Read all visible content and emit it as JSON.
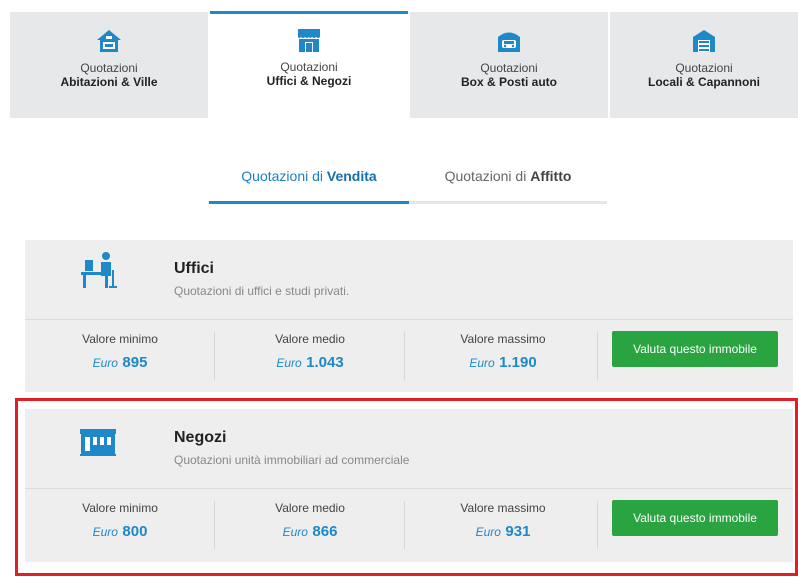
{
  "category_tabs": [
    {
      "line1": "Quotazioni",
      "line2": "Abitazioni & Ville",
      "icon": "house-icon",
      "active": false
    },
    {
      "line1": "Quotazioni",
      "line2": "Uffici & Negozi",
      "icon": "shop-icon",
      "active": true
    },
    {
      "line1": "Quotazioni",
      "line2": "Box & Posti auto",
      "icon": "garage-car-icon",
      "active": false
    },
    {
      "line1": "Quotazioni",
      "line2": "Locali & Capannoni",
      "icon": "warehouse-icon",
      "active": false
    }
  ],
  "mode_tabs": [
    {
      "prefix": "Quotazioni di",
      "strong": "Vendita",
      "active": true
    },
    {
      "prefix": "Quotazioni di",
      "strong": "Affitto",
      "active": false
    }
  ],
  "cards": [
    {
      "icon": "office-worker-icon",
      "title": "Uffici",
      "description": "Quotazioni di uffici e studi privati.",
      "stats": [
        {
          "label": "Valore minimo",
          "currency": "Euro",
          "value": "895"
        },
        {
          "label": "Valore medio",
          "currency": "Euro",
          "value": "1.043"
        },
        {
          "label": "Valore massimo",
          "currency": "Euro",
          "value": "1.190"
        }
      ],
      "cta": "Valuta questo immobile"
    },
    {
      "icon": "store-icon",
      "title": "Negozi",
      "description": "Quotazioni unità immobiliari ad commerciale",
      "stats": [
        {
          "label": "Valore minimo",
          "currency": "Euro",
          "value": "800"
        },
        {
          "label": "Valore medio",
          "currency": "Euro",
          "value": "866"
        },
        {
          "label": "Valore massimo",
          "currency": "Euro",
          "value": "931"
        }
      ],
      "cta": "Valuta questo immobile"
    }
  ],
  "colors": {
    "accent_blue": "#1e88c8",
    "cta_green": "#2aa341",
    "highlight_red": "#e01e26",
    "tab_inactive_bg": "#e6e8ea",
    "card_bg": "#eeeeee"
  }
}
